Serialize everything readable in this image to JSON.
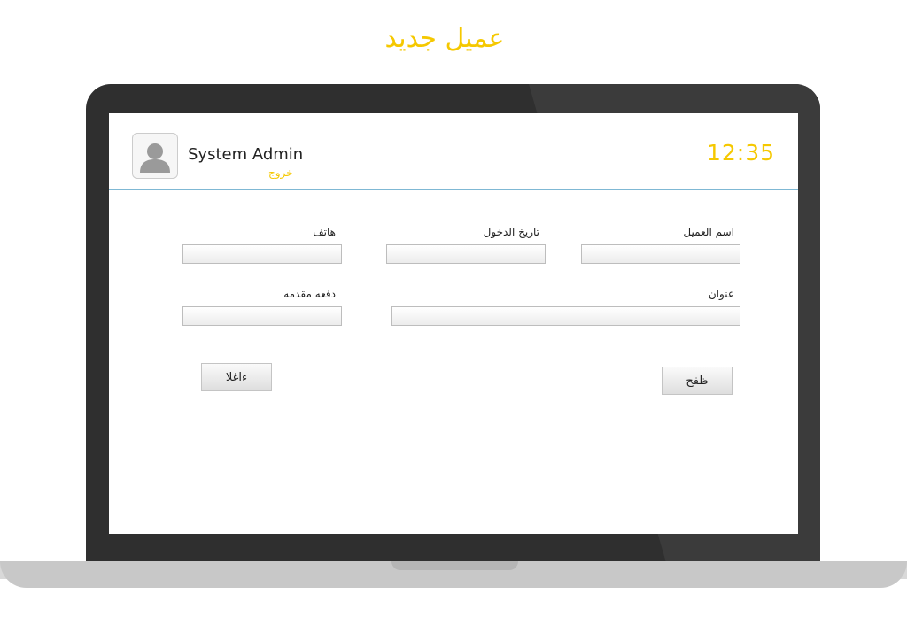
{
  "page": {
    "title": "عميل جديد"
  },
  "header": {
    "user_name": "System Admin",
    "logout_label": "خروج",
    "clock": "12:35"
  },
  "form": {
    "customer_name": {
      "label": "اسم العميل",
      "value": ""
    },
    "entry_date": {
      "label": "تاريخ الدخول",
      "value": ""
    },
    "phone": {
      "label": "هاتف",
      "value": ""
    },
    "address": {
      "label": "عنوان",
      "value": ""
    },
    "down_payment": {
      "label": "دفعه مقدمه",
      "value": ""
    }
  },
  "buttons": {
    "save_label": "ظفح",
    "cancel_label": "ءاغلا"
  },
  "colors": {
    "accent": "#f5c800",
    "header_divider": "#7fb8d4",
    "laptop_frame": "#2f2f2f"
  },
  "icons": {
    "avatar": "user-silhouette-icon"
  }
}
